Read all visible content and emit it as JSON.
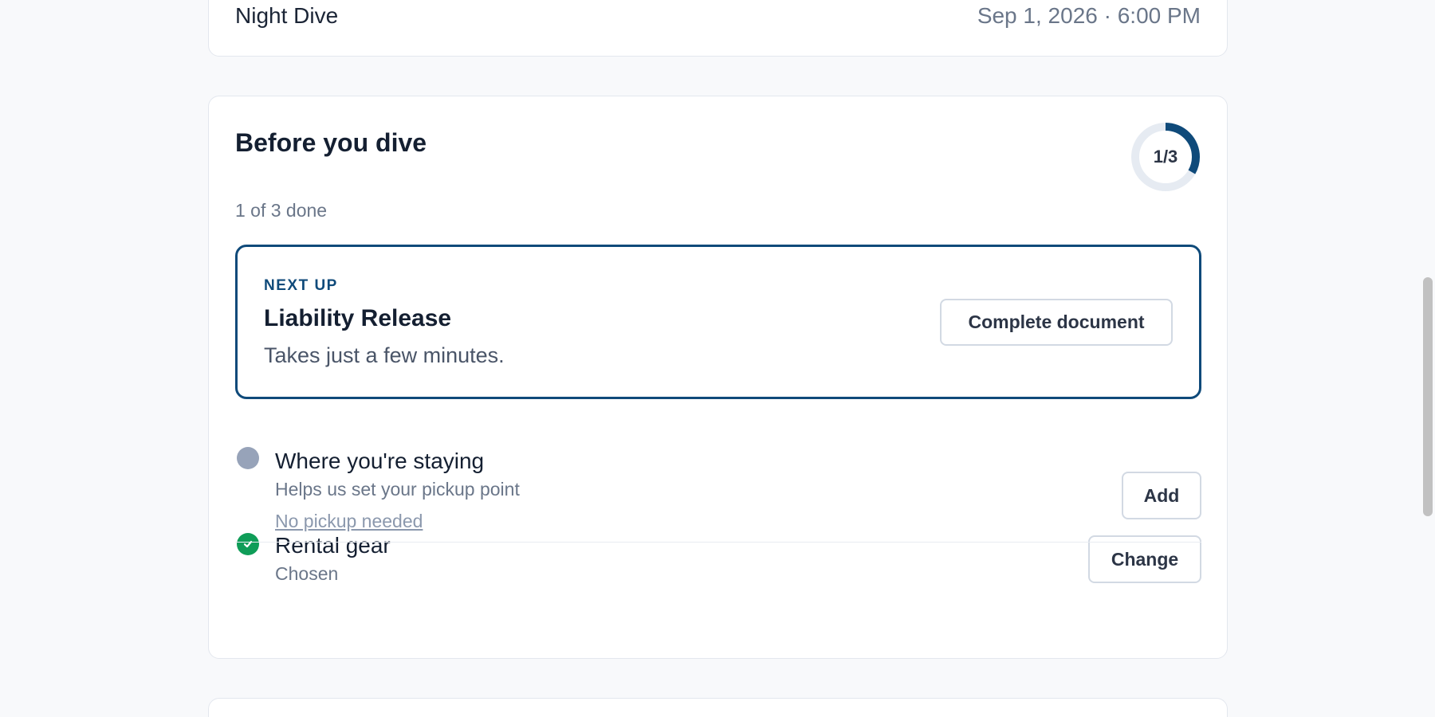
{
  "trip": {
    "name": "Night Dive",
    "datetime": "Sep 1, 2026 · 6:00 PM"
  },
  "checklist": {
    "title": "Before you dive",
    "progress_text": "1 of 3 done",
    "progress_label": "1/3",
    "progress_fraction": 0.333,
    "next_up": {
      "eyebrow": "NEXT UP",
      "title": "Liability Release",
      "description": "Takes just a few minutes.",
      "button_label": "Complete document"
    },
    "tasks": [
      {
        "title": "Where you're staying",
        "description": "Helps us set your pickup point",
        "link_label": "No pickup needed",
        "button_label": "Add",
        "status": "pending"
      },
      {
        "title": "Rental gear",
        "description": "Chosen",
        "button_label": "Change",
        "status": "done"
      }
    ]
  },
  "colors": {
    "accent": "#0f4a7a",
    "ring_track": "#e6ebf2",
    "done": "#0f9d58",
    "pending": "#97a3b9",
    "page_bg": "#f8f9fb"
  }
}
